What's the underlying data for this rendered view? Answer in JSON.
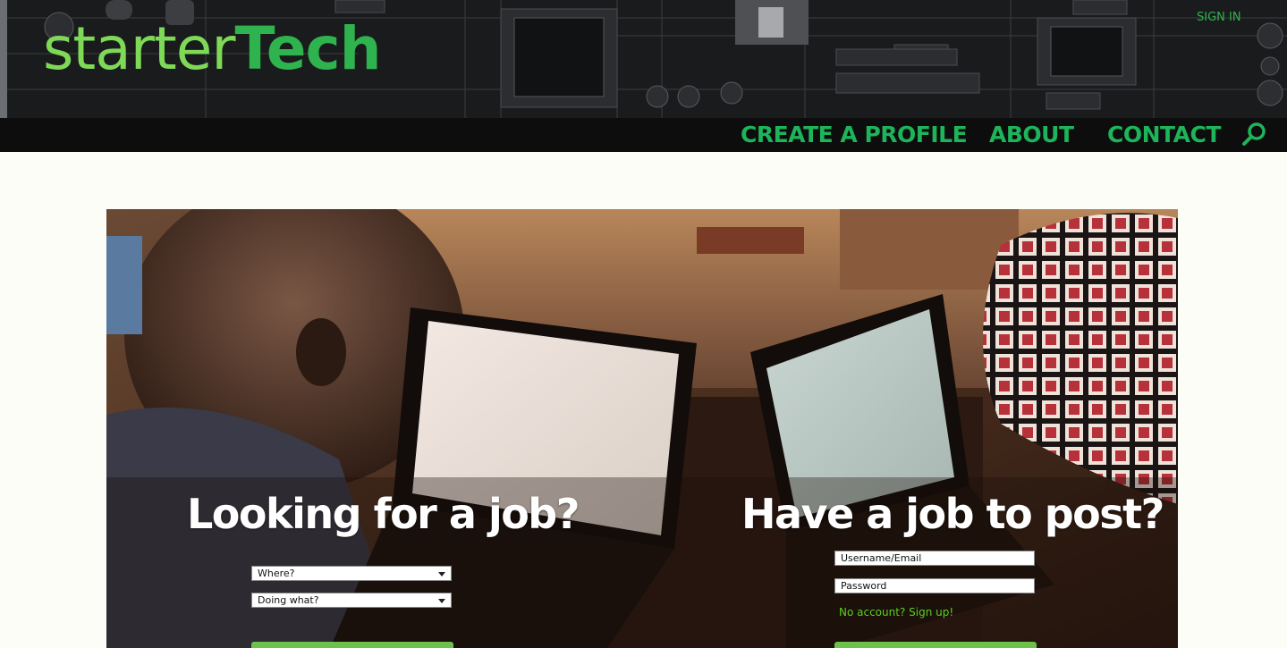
{
  "header": {
    "logo_light": "starter",
    "logo_dark": "Tech",
    "signin_label": "SIGN IN"
  },
  "nav": {
    "items": [
      {
        "label": "CREATE A PROFILE"
      },
      {
        "label": "ABOUT"
      },
      {
        "label": "CONTACT"
      }
    ],
    "search_icon": "search-icon"
  },
  "hero": {
    "jobseeker": {
      "title": "Looking for a job?",
      "where_select": "Where?",
      "what_select": "Doing what?"
    },
    "employer": {
      "title": "Have a job to post?",
      "username_placeholder": "Username/Email",
      "password_placeholder": "Password",
      "signup_link": "No account? Sign up!"
    }
  },
  "colors": {
    "accent_green": "#1db45a",
    "logo_light_green": "#7ed957",
    "header_bg": "#1a1b1c",
    "nav_bg": "#0d0d0e",
    "page_bg": "#fcfdf7",
    "button_green": "#6cc24a"
  }
}
